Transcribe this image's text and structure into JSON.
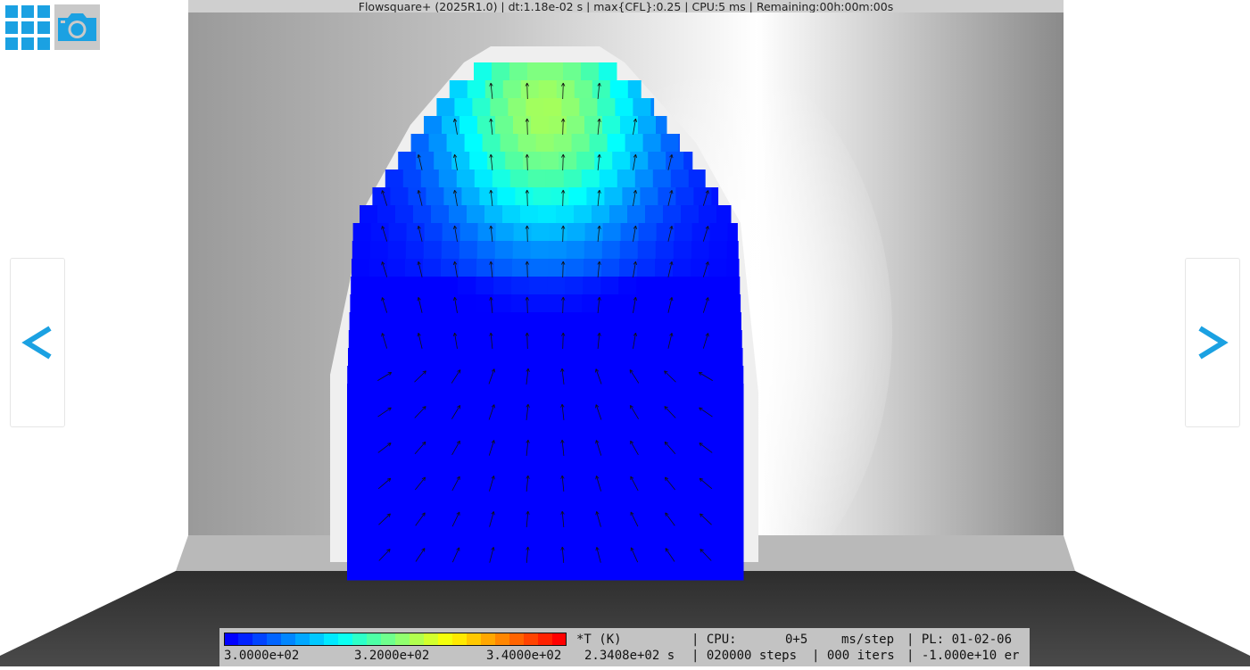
{
  "title_bar": {
    "text": "Flowsquare+ (2025R1.0) | dt:1.18e-02 s | max{CFL}:0.25 | CPU:5 ms | Remaining:00h:00m:00s"
  },
  "toolbar": {
    "gallery_icon": "grid-icon",
    "camera_icon": "camera-icon"
  },
  "navigation": {
    "prev_label": "<",
    "next_label": ">"
  },
  "colors": {
    "accent": "#1ba1e2",
    "background": "#ffffff",
    "status_panel": "#c3c3c3"
  },
  "status_panel": {
    "colorbar": {
      "stops": [
        "#0000ff",
        "#0040ff",
        "#0080ff",
        "#00c0ff",
        "#00ffff",
        "#40ffb0",
        "#80ff80",
        "#c0ff40",
        "#ffff00",
        "#ffc000",
        "#ff8000",
        "#ff4000",
        "#ff0000"
      ],
      "min_label": "3.0000e+02",
      "mid_label": "3.2000e+02",
      "max_label": "3.4000e+02"
    },
    "variable": "*T (K)",
    "time": "2.3408e+02 s",
    "cpu_label": "| CPU:",
    "cpu_value": "0+5",
    "cpu_unit": "ms/step",
    "steps": "| 020000 steps",
    "pl": "| PL: 01-02-06",
    "iters": "| 000 iters",
    "error": "| -1.000e+10 er"
  }
}
